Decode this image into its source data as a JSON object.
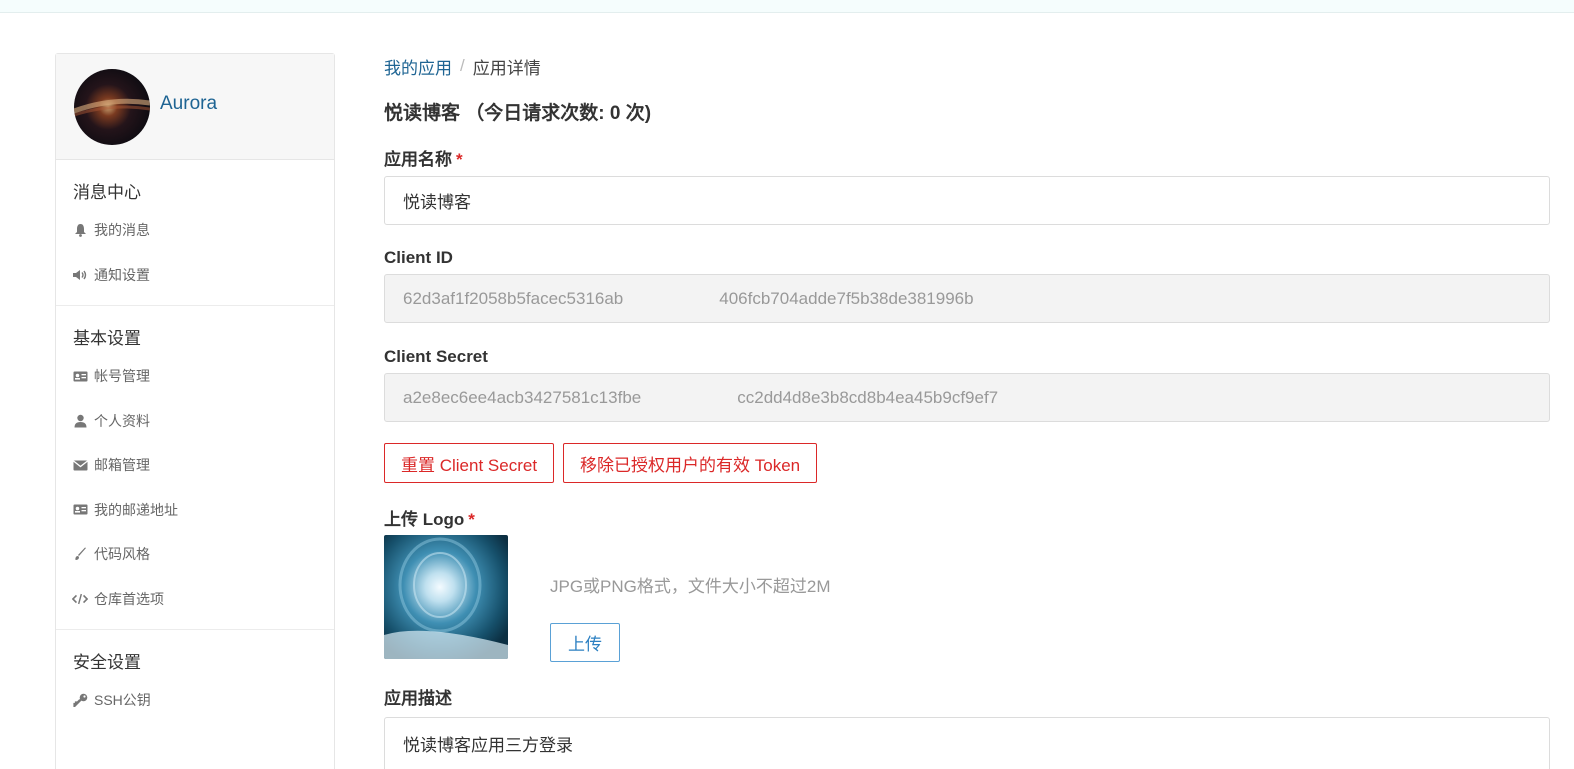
{
  "user": {
    "name": "Aurora"
  },
  "sidebar": {
    "groups": [
      {
        "title": "消息中心",
        "items": [
          {
            "icon": "bell-icon",
            "label": "我的消息"
          },
          {
            "icon": "megaphone-icon",
            "label": "通知设置"
          }
        ]
      },
      {
        "title": "基本设置",
        "items": [
          {
            "icon": "id-card-icon",
            "label": "帐号管理"
          },
          {
            "icon": "user-icon",
            "label": "个人资料"
          },
          {
            "icon": "envelope-icon",
            "label": "邮箱管理"
          },
          {
            "icon": "address-card-icon",
            "label": "我的邮递地址"
          },
          {
            "icon": "brush-icon",
            "label": "代码风格"
          },
          {
            "icon": "code-icon",
            "label": "仓库首选项"
          }
        ]
      },
      {
        "title": "安全设置",
        "items": [
          {
            "icon": "key-icon",
            "label": "SSH公钥"
          }
        ]
      }
    ]
  },
  "breadcrumb": {
    "parent": "我的应用",
    "separator": "/",
    "current": "应用详情"
  },
  "app": {
    "title": "悦读博客 （今日请求次数: 0 次)",
    "name_label": "应用名称",
    "name_value": "悦读博客",
    "client_id_label": "Client ID",
    "client_id_start": "62d3af1f2058b5facec5316ab",
    "client_id_end": "406fcb704adde7f5b38de381996b",
    "client_secret_label": "Client Secret",
    "client_secret_start": "a2e8ec6ee4acb3427581c13fbe",
    "client_secret_end": "cc2dd4d8e3b8cd8b4ea45b9cf9ef7",
    "reset_secret_label": "重置 Client Secret",
    "revoke_tokens_label": "移除已授权用户的有效 Token",
    "logo_label": "上传 Logo",
    "logo_hint": "JPG或PNG格式，文件大小不超过2M",
    "upload_label": "上传",
    "desc_label": "应用描述",
    "desc_value": "悦读博客应用三方登录",
    "required_mark": "*"
  },
  "colors": {
    "link": "#1e6493",
    "danger": "#db2828",
    "primary": "#2c80c2"
  }
}
